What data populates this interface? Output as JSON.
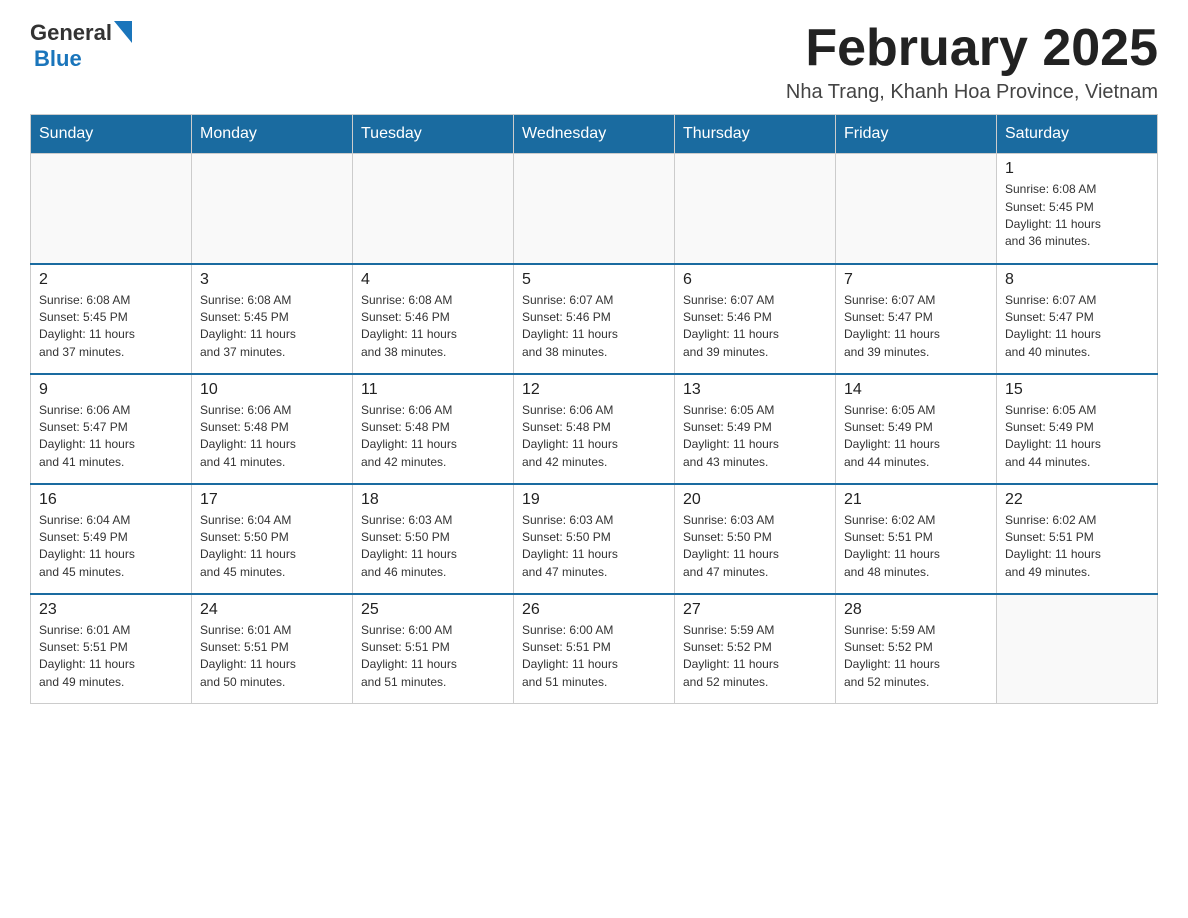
{
  "logo": {
    "general": "General",
    "blue": "Blue"
  },
  "title": {
    "month_year": "February 2025",
    "location": "Nha Trang, Khanh Hoa Province, Vietnam"
  },
  "weekdays": [
    "Sunday",
    "Monday",
    "Tuesday",
    "Wednesday",
    "Thursday",
    "Friday",
    "Saturday"
  ],
  "weeks": [
    [
      {
        "day": "",
        "info": ""
      },
      {
        "day": "",
        "info": ""
      },
      {
        "day": "",
        "info": ""
      },
      {
        "day": "",
        "info": ""
      },
      {
        "day": "",
        "info": ""
      },
      {
        "day": "",
        "info": ""
      },
      {
        "day": "1",
        "info": "Sunrise: 6:08 AM\nSunset: 5:45 PM\nDaylight: 11 hours\nand 36 minutes."
      }
    ],
    [
      {
        "day": "2",
        "info": "Sunrise: 6:08 AM\nSunset: 5:45 PM\nDaylight: 11 hours\nand 37 minutes."
      },
      {
        "day": "3",
        "info": "Sunrise: 6:08 AM\nSunset: 5:45 PM\nDaylight: 11 hours\nand 37 minutes."
      },
      {
        "day": "4",
        "info": "Sunrise: 6:08 AM\nSunset: 5:46 PM\nDaylight: 11 hours\nand 38 minutes."
      },
      {
        "day": "5",
        "info": "Sunrise: 6:07 AM\nSunset: 5:46 PM\nDaylight: 11 hours\nand 38 minutes."
      },
      {
        "day": "6",
        "info": "Sunrise: 6:07 AM\nSunset: 5:46 PM\nDaylight: 11 hours\nand 39 minutes."
      },
      {
        "day": "7",
        "info": "Sunrise: 6:07 AM\nSunset: 5:47 PM\nDaylight: 11 hours\nand 39 minutes."
      },
      {
        "day": "8",
        "info": "Sunrise: 6:07 AM\nSunset: 5:47 PM\nDaylight: 11 hours\nand 40 minutes."
      }
    ],
    [
      {
        "day": "9",
        "info": "Sunrise: 6:06 AM\nSunset: 5:47 PM\nDaylight: 11 hours\nand 41 minutes."
      },
      {
        "day": "10",
        "info": "Sunrise: 6:06 AM\nSunset: 5:48 PM\nDaylight: 11 hours\nand 41 minutes."
      },
      {
        "day": "11",
        "info": "Sunrise: 6:06 AM\nSunset: 5:48 PM\nDaylight: 11 hours\nand 42 minutes."
      },
      {
        "day": "12",
        "info": "Sunrise: 6:06 AM\nSunset: 5:48 PM\nDaylight: 11 hours\nand 42 minutes."
      },
      {
        "day": "13",
        "info": "Sunrise: 6:05 AM\nSunset: 5:49 PM\nDaylight: 11 hours\nand 43 minutes."
      },
      {
        "day": "14",
        "info": "Sunrise: 6:05 AM\nSunset: 5:49 PM\nDaylight: 11 hours\nand 44 minutes."
      },
      {
        "day": "15",
        "info": "Sunrise: 6:05 AM\nSunset: 5:49 PM\nDaylight: 11 hours\nand 44 minutes."
      }
    ],
    [
      {
        "day": "16",
        "info": "Sunrise: 6:04 AM\nSunset: 5:49 PM\nDaylight: 11 hours\nand 45 minutes."
      },
      {
        "day": "17",
        "info": "Sunrise: 6:04 AM\nSunset: 5:50 PM\nDaylight: 11 hours\nand 45 minutes."
      },
      {
        "day": "18",
        "info": "Sunrise: 6:03 AM\nSunset: 5:50 PM\nDaylight: 11 hours\nand 46 minutes."
      },
      {
        "day": "19",
        "info": "Sunrise: 6:03 AM\nSunset: 5:50 PM\nDaylight: 11 hours\nand 47 minutes."
      },
      {
        "day": "20",
        "info": "Sunrise: 6:03 AM\nSunset: 5:50 PM\nDaylight: 11 hours\nand 47 minutes."
      },
      {
        "day": "21",
        "info": "Sunrise: 6:02 AM\nSunset: 5:51 PM\nDaylight: 11 hours\nand 48 minutes."
      },
      {
        "day": "22",
        "info": "Sunrise: 6:02 AM\nSunset: 5:51 PM\nDaylight: 11 hours\nand 49 minutes."
      }
    ],
    [
      {
        "day": "23",
        "info": "Sunrise: 6:01 AM\nSunset: 5:51 PM\nDaylight: 11 hours\nand 49 minutes."
      },
      {
        "day": "24",
        "info": "Sunrise: 6:01 AM\nSunset: 5:51 PM\nDaylight: 11 hours\nand 50 minutes."
      },
      {
        "day": "25",
        "info": "Sunrise: 6:00 AM\nSunset: 5:51 PM\nDaylight: 11 hours\nand 51 minutes."
      },
      {
        "day": "26",
        "info": "Sunrise: 6:00 AM\nSunset: 5:51 PM\nDaylight: 11 hours\nand 51 minutes."
      },
      {
        "day": "27",
        "info": "Sunrise: 5:59 AM\nSunset: 5:52 PM\nDaylight: 11 hours\nand 52 minutes."
      },
      {
        "day": "28",
        "info": "Sunrise: 5:59 AM\nSunset: 5:52 PM\nDaylight: 11 hours\nand 52 minutes."
      },
      {
        "day": "",
        "info": ""
      }
    ]
  ]
}
